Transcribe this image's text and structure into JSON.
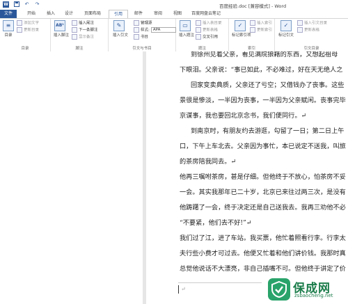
{
  "window": {
    "title": "百度经验.doc [兼容模式] - Word"
  },
  "quick_access": {
    "app_icon": "W",
    "save_icon": "save-icon",
    "undo_icon": "↶",
    "redo_icon": "↷"
  },
  "tabs": [
    "文件",
    "开始",
    "插入",
    "设计",
    "页面布局",
    "引用",
    "邮件",
    "审阅",
    "视图",
    "百度网盘云笔记"
  ],
  "active_tab": "引用",
  "ribbon": {
    "toc": {
      "big_label": "目录",
      "add_text": "添加文字",
      "update_toc": "更新目录",
      "group": "目录"
    },
    "footnote": {
      "big_label": "插入脚注",
      "insert_endnote": "插入尾注",
      "next_footnote": "下一条脚注",
      "show_notes": "显示备注",
      "group": "脚注"
    },
    "citation": {
      "big_label": "插入引文",
      "manage_sources": "管理源",
      "style_label": "样式:",
      "style_value": "APA",
      "bibliography": "书目",
      "group": "引文与书目"
    },
    "caption": {
      "big_label": "插入题注",
      "insert_table_of_figures": "插入表目录",
      "update_table": "更新表格",
      "cross_reference": "交叉引用",
      "group": "题注"
    },
    "index": {
      "big_label": "标记索引项",
      "insert_index": "插入索引",
      "update_index": "更新索引",
      "group": "索引"
    },
    "authorities": {
      "big_label": "标记引文",
      "insert_table": "插入引文目录",
      "update_table": "更新表格",
      "group": "引文目录"
    }
  },
  "document": {
    "lines": [
      {
        "text": "到徐州见着父亲，看见满院狼藉的东西，又想起祖母",
        "indent": true
      },
      {
        "text": "下眼泪。父亲说：“事已如此，不必难过，好在天无绝人之",
        "indent": false
      },
      {
        "text": "回家变卖典质，父亲还了亏空；又借钱办了丧事。这些",
        "indent": true
      },
      {
        "text": "景很是惨淡，一半因为丧事，一半因为父亲赋闲。丧事完毕",
        "indent": false
      },
      {
        "text": "京谋事，我也要回北京念书，我们便同行。↵",
        "indent": false
      },
      {
        "text": "到南京时，有朋友约去游逛，勾留了一日；第二日上午",
        "indent": true
      },
      {
        "text": "口，下午上车北去。父亲因为事忙，本已说定不送我，叫旅",
        "indent": false
      },
      {
        "text": "的茶房陪我同去。↵",
        "indent": false
      },
      {
        "text": "他再三嘱咐茶房，甚是仔细。但他终于不放心，怕茶房不妥",
        "indent": false
      },
      {
        "text": "一会。其实我那年已二十岁，北京已来往过两三次，是没有",
        "indent": false
      },
      {
        "text": "他踌躇了一会，终于决定还是自己送我去。我再三劝他不必",
        "indent": false
      },
      {
        "text": "“不要紧，他们去不好!”↵",
        "indent": false
      },
      {
        "text": "我们过了江，进了车站。我买票，他忙着照看行李。行李太",
        "indent": false
      },
      {
        "text": "夫行些小费才可过去。他便又忙着和他们讲价钱。我那时真",
        "indent": false
      },
      {
        "text": "总觉他说话不大漂亮，非自己插嘴不可。但他终于讲定了价",
        "indent": false
      }
    ],
    "footnote_mark": "↵"
  },
  "watermark": {
    "name": "保成网",
    "url": "zsbaocheng.net"
  },
  "colors": {
    "word_blue": "#2b579a",
    "watermark_green": "#29a36a"
  }
}
